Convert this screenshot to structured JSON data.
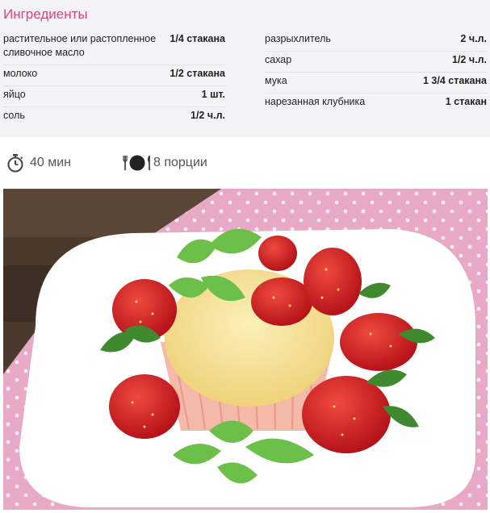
{
  "ingredients": {
    "title": "Ингредиенты",
    "left": [
      {
        "name": "растительное или растопленное сливочное масло",
        "qty": "1/4 стакана"
      },
      {
        "name": "молоко",
        "qty": "1/2 стакана"
      },
      {
        "name": "яйцо",
        "qty": "1 шт."
      },
      {
        "name": "соль",
        "qty": "1/2 ч.л."
      }
    ],
    "right": [
      {
        "name": "разрыхлитель",
        "qty": "2 ч.л."
      },
      {
        "name": "сахар",
        "qty": "1/2 ч.л."
      },
      {
        "name": "мука",
        "qty": "1 3/4 стакана"
      },
      {
        "name": "нарезанная клубника",
        "qty": "1 стакан"
      }
    ]
  },
  "meta": {
    "time": "40 мин",
    "time_icon": "stopwatch-icon",
    "servings": "8 порции",
    "servings_icon": "cutlery-plate-icon"
  },
  "colors": {
    "accent": "#e0457b",
    "panel_bg": "#f4f4f6"
  }
}
